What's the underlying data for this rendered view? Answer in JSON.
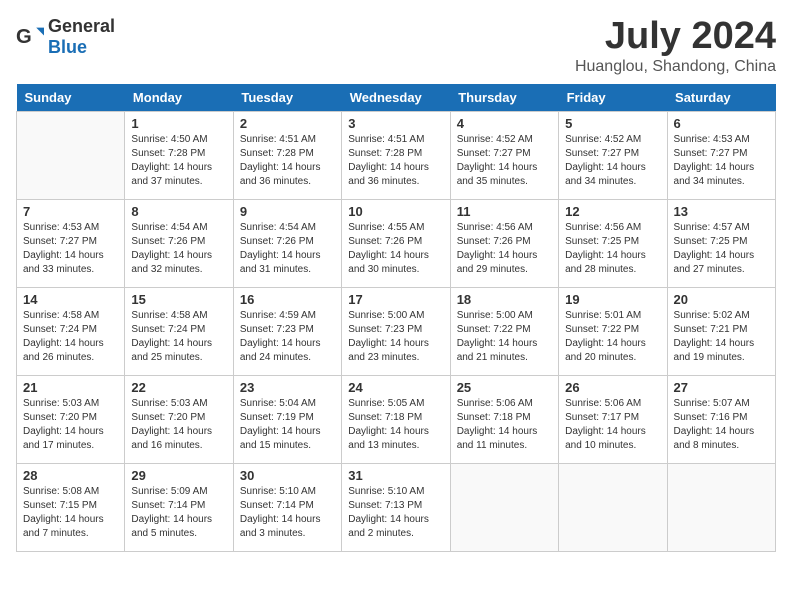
{
  "header": {
    "logo_general": "General",
    "logo_blue": "Blue",
    "month": "July 2024",
    "location": "Huanglou, Shandong, China"
  },
  "days_of_week": [
    "Sunday",
    "Monday",
    "Tuesday",
    "Wednesday",
    "Thursday",
    "Friday",
    "Saturday"
  ],
  "weeks": [
    [
      {
        "day": "",
        "empty": true
      },
      {
        "day": "1",
        "sunrise": "4:50 AM",
        "sunset": "7:28 PM",
        "daylight": "14 hours and 37 minutes."
      },
      {
        "day": "2",
        "sunrise": "4:51 AM",
        "sunset": "7:28 PM",
        "daylight": "14 hours and 36 minutes."
      },
      {
        "day": "3",
        "sunrise": "4:51 AM",
        "sunset": "7:28 PM",
        "daylight": "14 hours and 36 minutes."
      },
      {
        "day": "4",
        "sunrise": "4:52 AM",
        "sunset": "7:27 PM",
        "daylight": "14 hours and 35 minutes."
      },
      {
        "day": "5",
        "sunrise": "4:52 AM",
        "sunset": "7:27 PM",
        "daylight": "14 hours and 34 minutes."
      },
      {
        "day": "6",
        "sunrise": "4:53 AM",
        "sunset": "7:27 PM",
        "daylight": "14 hours and 34 minutes."
      }
    ],
    [
      {
        "day": "7",
        "sunrise": "4:53 AM",
        "sunset": "7:27 PM",
        "daylight": "14 hours and 33 minutes."
      },
      {
        "day": "8",
        "sunrise": "4:54 AM",
        "sunset": "7:26 PM",
        "daylight": "14 hours and 32 minutes."
      },
      {
        "day": "9",
        "sunrise": "4:54 AM",
        "sunset": "7:26 PM",
        "daylight": "14 hours and 31 minutes."
      },
      {
        "day": "10",
        "sunrise": "4:55 AM",
        "sunset": "7:26 PM",
        "daylight": "14 hours and 30 minutes."
      },
      {
        "day": "11",
        "sunrise": "4:56 AM",
        "sunset": "7:26 PM",
        "daylight": "14 hours and 29 minutes."
      },
      {
        "day": "12",
        "sunrise": "4:56 AM",
        "sunset": "7:25 PM",
        "daylight": "14 hours and 28 minutes."
      },
      {
        "day": "13",
        "sunrise": "4:57 AM",
        "sunset": "7:25 PM",
        "daylight": "14 hours and 27 minutes."
      }
    ],
    [
      {
        "day": "14",
        "sunrise": "4:58 AM",
        "sunset": "7:24 PM",
        "daylight": "14 hours and 26 minutes."
      },
      {
        "day": "15",
        "sunrise": "4:58 AM",
        "sunset": "7:24 PM",
        "daylight": "14 hours and 25 minutes."
      },
      {
        "day": "16",
        "sunrise": "4:59 AM",
        "sunset": "7:23 PM",
        "daylight": "14 hours and 24 minutes."
      },
      {
        "day": "17",
        "sunrise": "5:00 AM",
        "sunset": "7:23 PM",
        "daylight": "14 hours and 23 minutes."
      },
      {
        "day": "18",
        "sunrise": "5:00 AM",
        "sunset": "7:22 PM",
        "daylight": "14 hours and 21 minutes."
      },
      {
        "day": "19",
        "sunrise": "5:01 AM",
        "sunset": "7:22 PM",
        "daylight": "14 hours and 20 minutes."
      },
      {
        "day": "20",
        "sunrise": "5:02 AM",
        "sunset": "7:21 PM",
        "daylight": "14 hours and 19 minutes."
      }
    ],
    [
      {
        "day": "21",
        "sunrise": "5:03 AM",
        "sunset": "7:20 PM",
        "daylight": "14 hours and 17 minutes."
      },
      {
        "day": "22",
        "sunrise": "5:03 AM",
        "sunset": "7:20 PM",
        "daylight": "14 hours and 16 minutes."
      },
      {
        "day": "23",
        "sunrise": "5:04 AM",
        "sunset": "7:19 PM",
        "daylight": "14 hours and 15 minutes."
      },
      {
        "day": "24",
        "sunrise": "5:05 AM",
        "sunset": "7:18 PM",
        "daylight": "14 hours and 13 minutes."
      },
      {
        "day": "25",
        "sunrise": "5:06 AM",
        "sunset": "7:18 PM",
        "daylight": "14 hours and 11 minutes."
      },
      {
        "day": "26",
        "sunrise": "5:06 AM",
        "sunset": "7:17 PM",
        "daylight": "14 hours and 10 minutes."
      },
      {
        "day": "27",
        "sunrise": "5:07 AM",
        "sunset": "7:16 PM",
        "daylight": "14 hours and 8 minutes."
      }
    ],
    [
      {
        "day": "28",
        "sunrise": "5:08 AM",
        "sunset": "7:15 PM",
        "daylight": "14 hours and 7 minutes."
      },
      {
        "day": "29",
        "sunrise": "5:09 AM",
        "sunset": "7:14 PM",
        "daylight": "14 hours and 5 minutes."
      },
      {
        "day": "30",
        "sunrise": "5:10 AM",
        "sunset": "7:14 PM",
        "daylight": "14 hours and 3 minutes."
      },
      {
        "day": "31",
        "sunrise": "5:10 AM",
        "sunset": "7:13 PM",
        "daylight": "14 hours and 2 minutes."
      },
      {
        "day": "",
        "empty": true
      },
      {
        "day": "",
        "empty": true
      },
      {
        "day": "",
        "empty": true
      }
    ]
  ]
}
